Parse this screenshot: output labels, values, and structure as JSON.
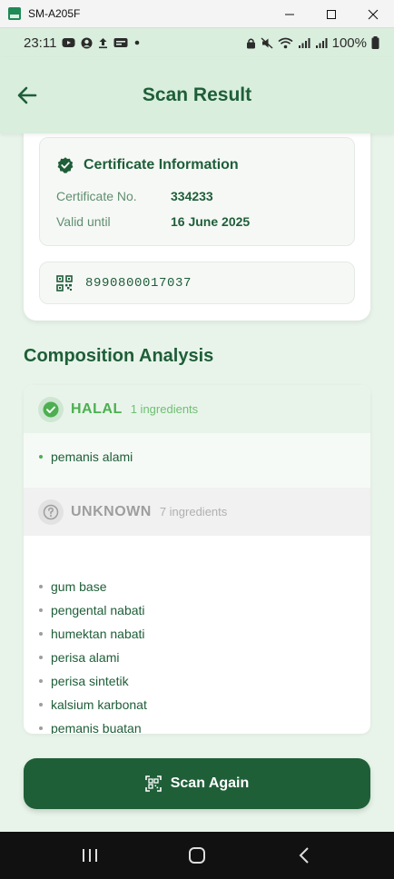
{
  "window": {
    "title": "SM-A205F"
  },
  "statusbar": {
    "time": "23:11",
    "battery": "100%"
  },
  "appbar": {
    "title": "Scan Result"
  },
  "certificate": {
    "heading": "Certificate Information",
    "number_label": "Certificate No.",
    "number_value": "334233",
    "valid_label": "Valid until",
    "valid_value": "16 June 2025",
    "barcode": "8990800017037"
  },
  "composition": {
    "title": "Composition Analysis",
    "halal": {
      "label": "HALAL",
      "count": "1 ingredients",
      "items": [
        "pemanis alami"
      ]
    },
    "unknown": {
      "label": "UNKNOWN",
      "count": "7 ingredients",
      "items": [
        "gum base",
        "pengental nabati",
        "humektan nabati",
        "perisa alami",
        "perisa sintetik",
        "kalsium karbonat",
        "pemanis buatan"
      ]
    }
  },
  "actions": {
    "scan_again": "Scan Again"
  },
  "colors": {
    "primary": "#1f5f38",
    "halal": "#4caf50",
    "unknown": "#9e9e9e",
    "background": "#e8f4ea",
    "appbar": "#d9eedd"
  },
  "icons": {
    "back": "arrow-left-icon",
    "certificate": "verified-badge-icon",
    "barcode": "qr-code-icon",
    "halal": "check-circle-icon",
    "unknown": "question-circle-icon",
    "scan": "qr-scan-icon"
  }
}
